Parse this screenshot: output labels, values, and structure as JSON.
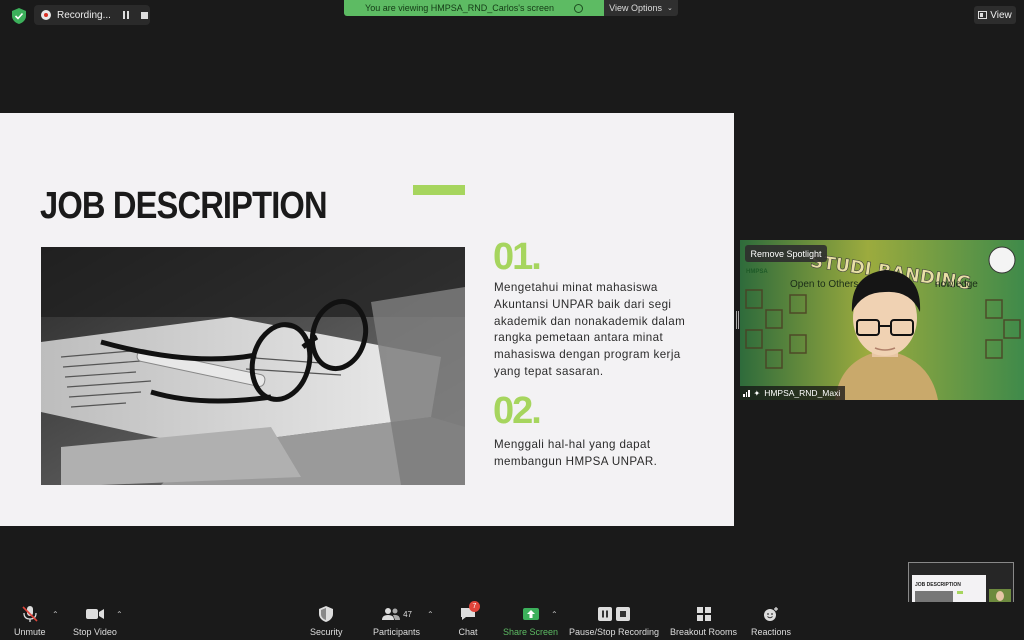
{
  "top": {
    "recording_label": "Recording...",
    "viewing_banner": "You are viewing HMPSA_RND_Carlos's screen",
    "view_options": "View Options",
    "view_button": "View"
  },
  "slide": {
    "title": "JOB DESCRIPTION",
    "items": [
      {
        "number": "01.",
        "text": "Mengetahui minat mahasiswa Akuntansi UNPAR baik dari segi akademik dan nonakademik dalam rangka pemetaan antara minat mahasiswa dengan program kerja yang tepat sasaran."
      },
      {
        "number": "02.",
        "text": "Menggali hal-hal yang dapat membangun HMPSA UNPAR."
      }
    ],
    "accent_color": "#a6d55e"
  },
  "video": {
    "remove_spotlight": "Remove Spotlight",
    "participant_name": "HMPSA_RND_Maxi",
    "banner_title": "STUDI BANDING",
    "banner_sub_left": "Open to Others,",
    "banner_sub_right": "nowledge",
    "org_logo": "HMPSA"
  },
  "toolbar": {
    "unmute": "Unmute",
    "stop_video": "Stop Video",
    "security": "Security",
    "participants": "Participants",
    "participants_count": "47",
    "chat": "Chat",
    "chat_badge": "7",
    "share_screen": "Share Screen",
    "pause_stop_recording": "Pause/Stop Recording",
    "breakout_rooms": "Breakout Rooms",
    "reactions": "Reactions"
  },
  "mini_view": {
    "title": "JOB DESCRIPTION"
  }
}
